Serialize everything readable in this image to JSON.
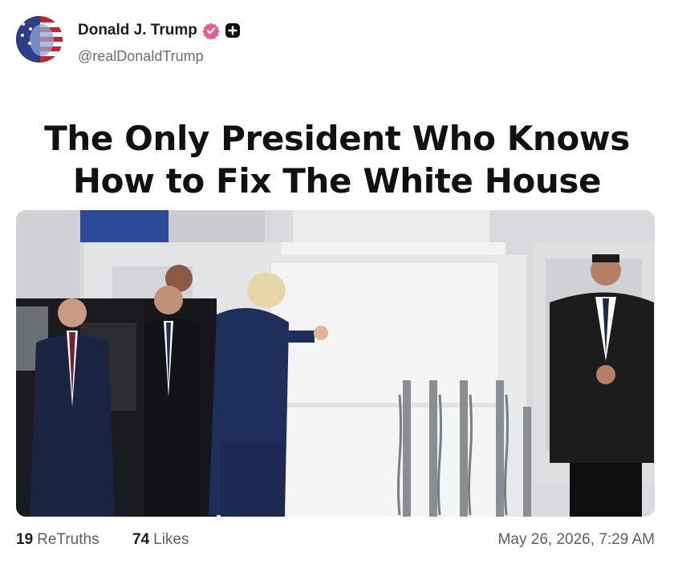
{
  "post": {
    "author": {
      "display_name": "Donald J. Trump",
      "handle": "@realDonaldTrump",
      "verified_icon": "verified-badge-icon",
      "verified_color": "#e85a9b",
      "plus_icon": "plus-badge-icon"
    },
    "headline_line1": "The Only President Who Knows",
    "headline_line2": "How to Fix The White House",
    "stats": {
      "retruths_count": "19",
      "retruths_label": "ReTruths",
      "likes_count": "74",
      "likes_label": "Likes"
    },
    "timestamp": "May 26, 2026, 7:29 AM"
  }
}
